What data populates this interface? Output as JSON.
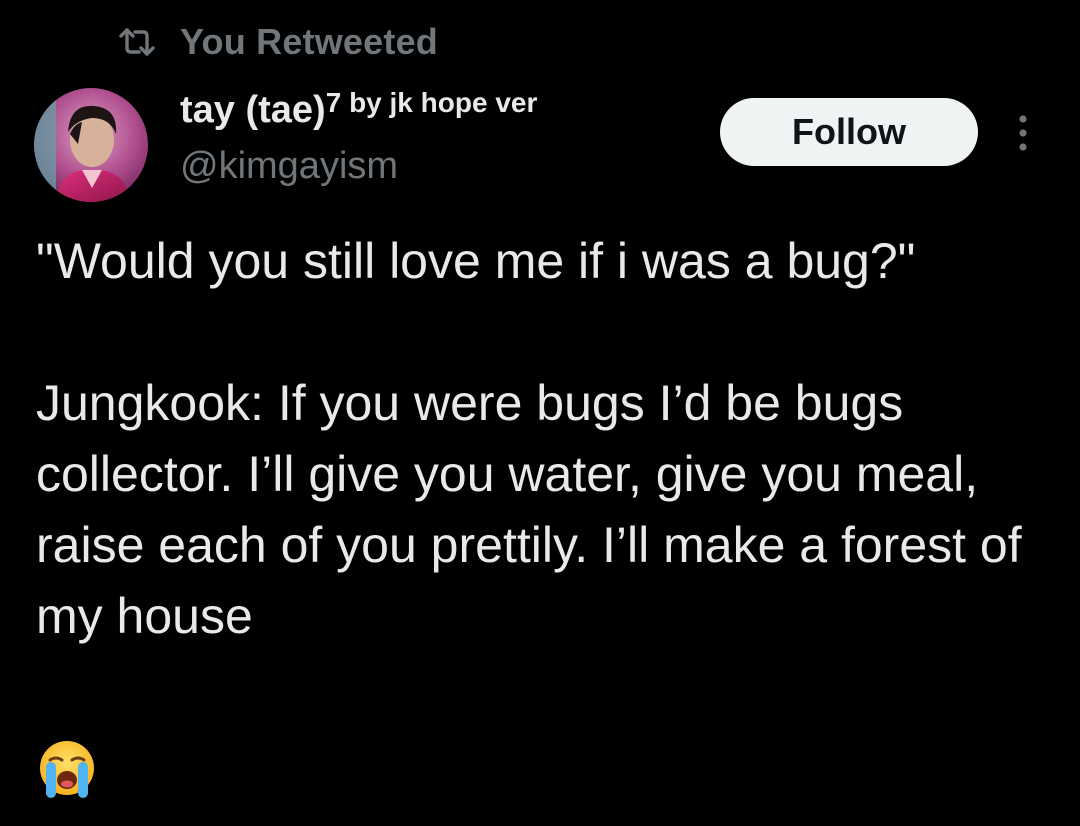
{
  "retweet": {
    "icon": "retweet-icon",
    "label": "You Retweeted"
  },
  "author": {
    "display_name": "tay (tae)",
    "name_superscript": "7",
    "name_suffix": " by jk hope ver",
    "handle": "@kimgayism",
    "avatar_icon": "profile-avatar"
  },
  "actions": {
    "follow_label": "Follow",
    "more_icon": "more-options-icon"
  },
  "tweet": {
    "text": "\"Would you still love me if i was a bug?\"\n\nJungkook: If you were bugs I’d be bugs collector. I’ll give you water, give you meal, raise each of you prettily. I’ll make a forest of my house\n\n",
    "emoji_icon": "loudly-crying-face-emoji"
  },
  "colors": {
    "background": "#000000",
    "primary_text": "#e7e9ea",
    "secondary_text": "#71767b",
    "follow_button_bg": "#eff3f4",
    "follow_button_text": "#0f1419"
  }
}
